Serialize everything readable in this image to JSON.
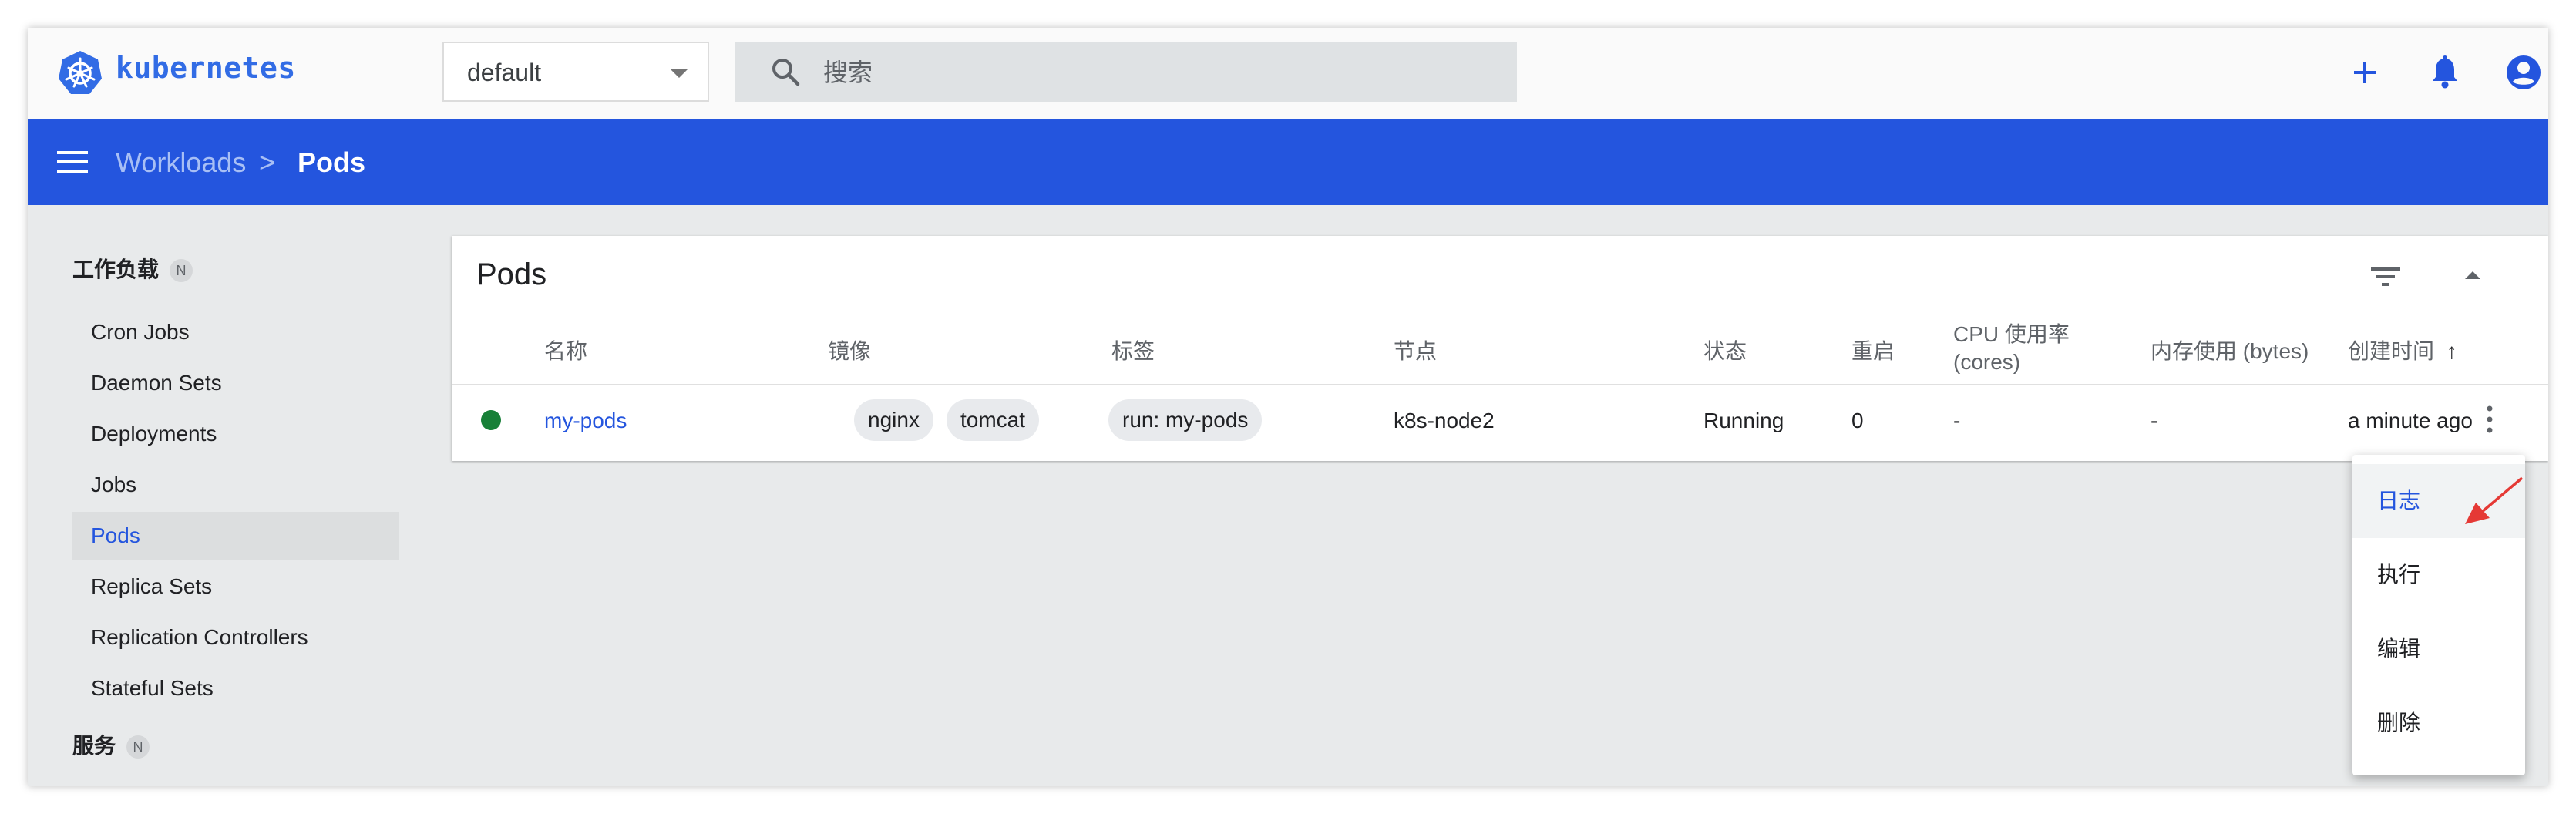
{
  "app": {
    "logo_text": "kubernetes",
    "accent": "#326ce5",
    "header_color": "#2455de"
  },
  "toolbar": {
    "namespace": "default",
    "search_placeholder": "搜索",
    "icons": [
      "add-icon",
      "bell-icon",
      "account-icon"
    ]
  },
  "breadcrumb": {
    "parent": "Workloads",
    "separator": ">",
    "current": "Pods"
  },
  "sidebar": {
    "heading_workloads": "工作负载",
    "badge": "N",
    "items": [
      {
        "label": "Cron Jobs"
      },
      {
        "label": "Daemon Sets"
      },
      {
        "label": "Deployments"
      },
      {
        "label": "Jobs"
      },
      {
        "label": "Pods",
        "active": true
      },
      {
        "label": "Replica Sets"
      },
      {
        "label": "Replication Controllers"
      },
      {
        "label": "Stateful Sets"
      }
    ],
    "heading_services": "服务"
  },
  "pods_card": {
    "title": "Pods",
    "columns": {
      "name": "名称",
      "images": "镜像",
      "labels": "标签",
      "node": "节点",
      "status": "状态",
      "restarts": "重启",
      "cpu_line1": "CPU 使用率",
      "cpu_line2": "(cores)",
      "memory": "内存使用 (bytes)",
      "created": "创建时间",
      "sort_arrow": "↑"
    },
    "rows": [
      {
        "status_color": "#188038",
        "name": "my-pods",
        "images": [
          "nginx",
          "tomcat"
        ],
        "label": "run: my-pods",
        "node": "k8s-node2",
        "status": "Running",
        "restarts": "0",
        "cpu": "-",
        "memory": "-",
        "created": "a minute ago"
      }
    ]
  },
  "context_menu": {
    "items": [
      {
        "label": "日志",
        "highlighted": true
      },
      {
        "label": "执行"
      },
      {
        "label": "编辑"
      },
      {
        "label": "删除"
      }
    ]
  }
}
